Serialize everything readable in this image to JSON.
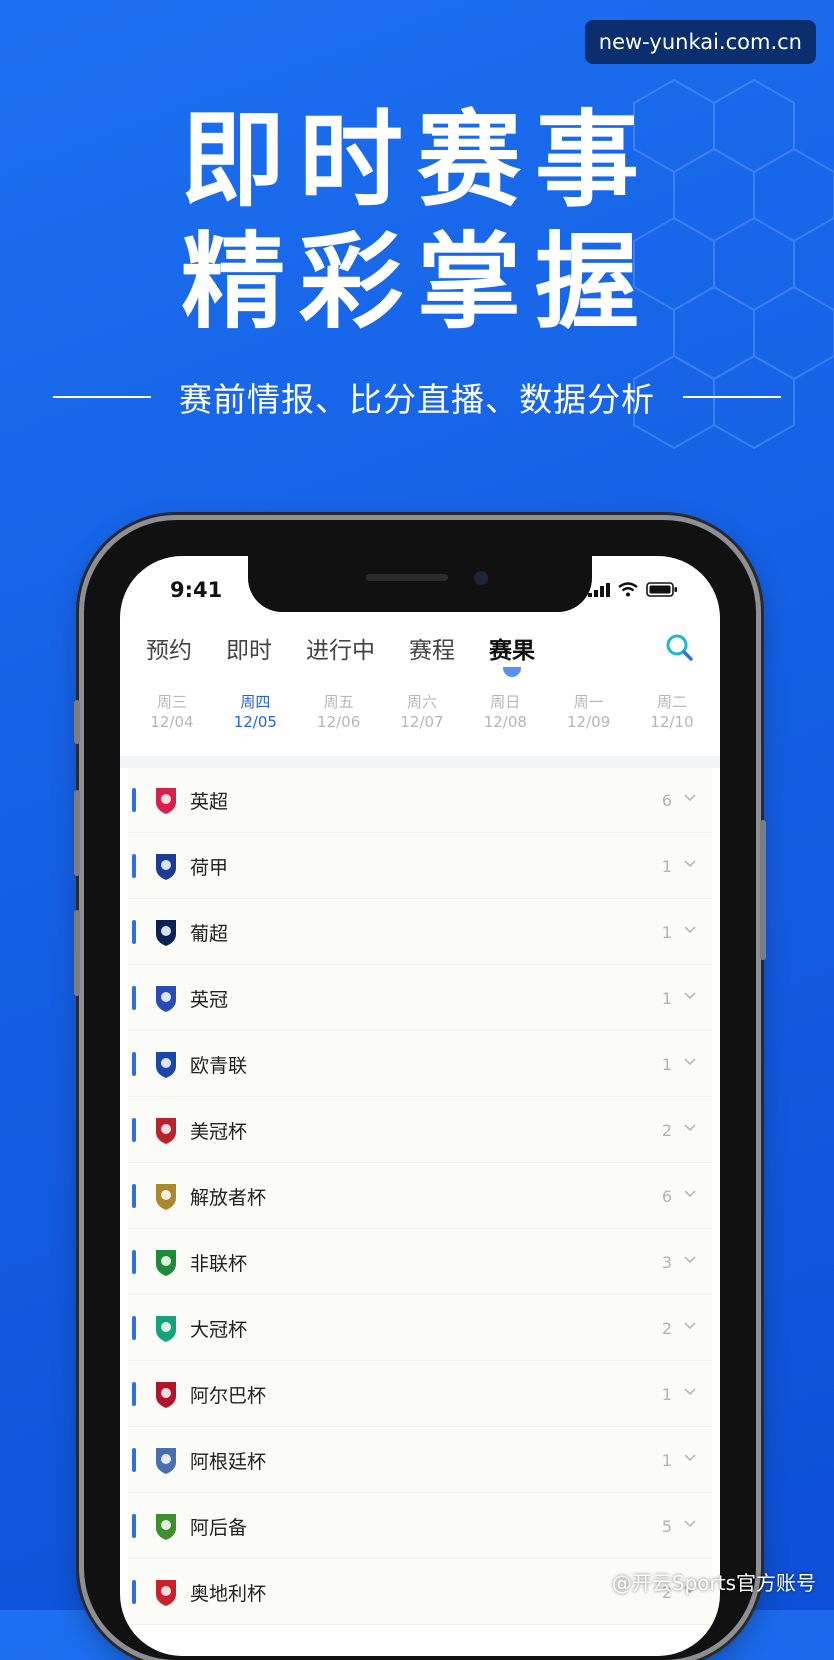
{
  "site_badge": "new-yunkai.com.cn",
  "headline": {
    "line1": "即时赛事",
    "line2": "精彩掌握"
  },
  "subline": "赛前情报、比分直播、数据分析",
  "status": {
    "time": "9:41"
  },
  "tabs": [
    {
      "label": "预约"
    },
    {
      "label": "即时"
    },
    {
      "label": "进行中"
    },
    {
      "label": "赛程"
    },
    {
      "label": "赛果"
    }
  ],
  "dates": [
    {
      "day": "周三",
      "date": "12/04"
    },
    {
      "day": "周四",
      "date": "12/05"
    },
    {
      "day": "周五",
      "date": "12/06"
    },
    {
      "day": "周六",
      "date": "12/07"
    },
    {
      "day": "周日",
      "date": "12/08"
    },
    {
      "day": "周一",
      "date": "12/09"
    },
    {
      "day": "周二",
      "date": "12/10"
    }
  ],
  "leagues": [
    {
      "name": "英超",
      "count": "6",
      "logo_color": "#d6204b",
      "logo": "premier-league-icon"
    },
    {
      "name": "荷甲",
      "count": "1",
      "logo_color": "#1c3d91",
      "logo": "eredivisie-icon"
    },
    {
      "name": "葡超",
      "count": "1",
      "logo_color": "#0b2354",
      "logo": "liga-portugal-icon"
    },
    {
      "name": "英冠",
      "count": "1",
      "logo_color": "#2a4ab8",
      "logo": "efl-championship-icon"
    },
    {
      "name": "欧青联",
      "count": "1",
      "logo_color": "#1b48a6",
      "logo": "youth-league-icon"
    },
    {
      "name": "美冠杯",
      "count": "2",
      "logo_color": "#b8232f",
      "logo": "concacaf-cup-icon"
    },
    {
      "name": "解放者杯",
      "count": "6",
      "logo_color": "#a88a2e",
      "logo": "libertadores-icon"
    },
    {
      "name": "非联杯",
      "count": "3",
      "logo_color": "#1f8a3a",
      "logo": "caf-cup-icon"
    },
    {
      "name": "大冠杯",
      "count": "2",
      "logo_color": "#14a37a",
      "logo": "ofc-champions-icon"
    },
    {
      "name": "阿尔巴杯",
      "count": "1",
      "logo_color": "#b0162a",
      "logo": "albania-cup-icon"
    },
    {
      "name": "阿根廷杯",
      "count": "1",
      "logo_color": "#4a6fb0",
      "logo": "argentina-cup-icon"
    },
    {
      "name": "阿后备",
      "count": "5",
      "logo_color": "#3f8f2e",
      "logo": "argentina-reserve-icon"
    },
    {
      "name": "奥地利杯",
      "count": "2",
      "logo_color": "#c8202c",
      "logo": "austria-cup-icon"
    }
  ],
  "watermark": "@开云Sports官方账号",
  "colors": {
    "background": "#1560e4",
    "accent": "#2f6fe5",
    "active_date": "#2563d8"
  }
}
